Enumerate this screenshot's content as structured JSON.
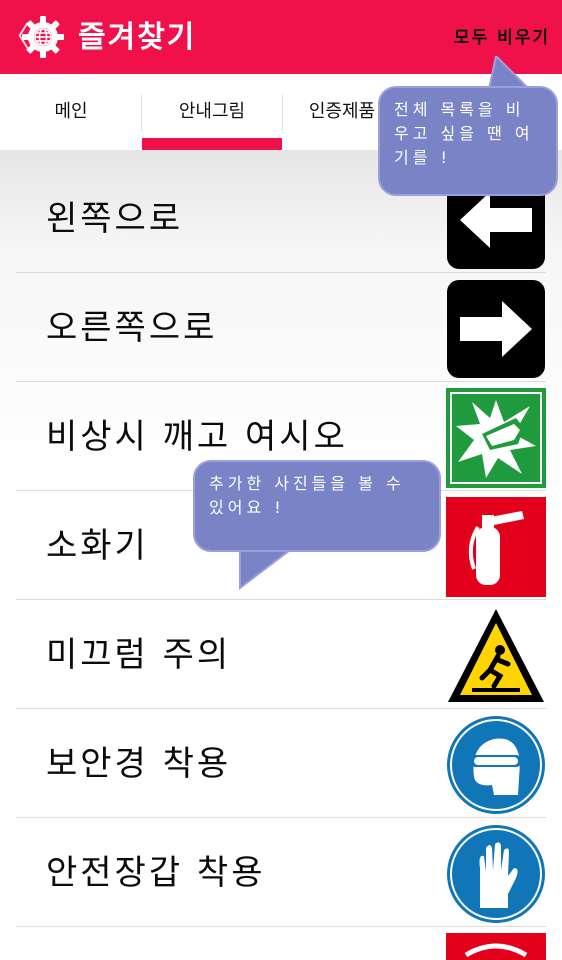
{
  "appbar": {
    "back_glyph": "〈",
    "logo_icon": "gear-globe-icon",
    "title": "즐겨찾기",
    "clear_all": "모두 비우기",
    "color": "#f0104a"
  },
  "tabs": [
    {
      "label": "메인",
      "selected": false
    },
    {
      "label": "안내그림",
      "selected": true
    },
    {
      "label": "인증제품",
      "selected": false
    }
  ],
  "items": [
    {
      "label": "왼쪽으로",
      "icon": "arrow-left-icon"
    },
    {
      "label": "오른쪽으로",
      "icon": "arrow-right-icon"
    },
    {
      "label": "비상시 깨고 여시오",
      "icon": "break-glass-icon"
    },
    {
      "label": "소화기",
      "icon": "fire-extinguisher-icon"
    },
    {
      "label": "미끄럼 주의",
      "icon": "slippery-warning-icon"
    },
    {
      "label": "보안경 착용",
      "icon": "safety-goggles-icon"
    },
    {
      "label": "안전장갑 착용",
      "icon": "safety-gloves-icon"
    },
    {
      "label": "",
      "icon": "partial-red-sign-icon"
    }
  ],
  "tooltips": {
    "clear_hint": "전체 목록을 비우고 싶을 땐 여기를 !",
    "list_hint": "추가한 사진들을 볼 수 있어요 !"
  }
}
